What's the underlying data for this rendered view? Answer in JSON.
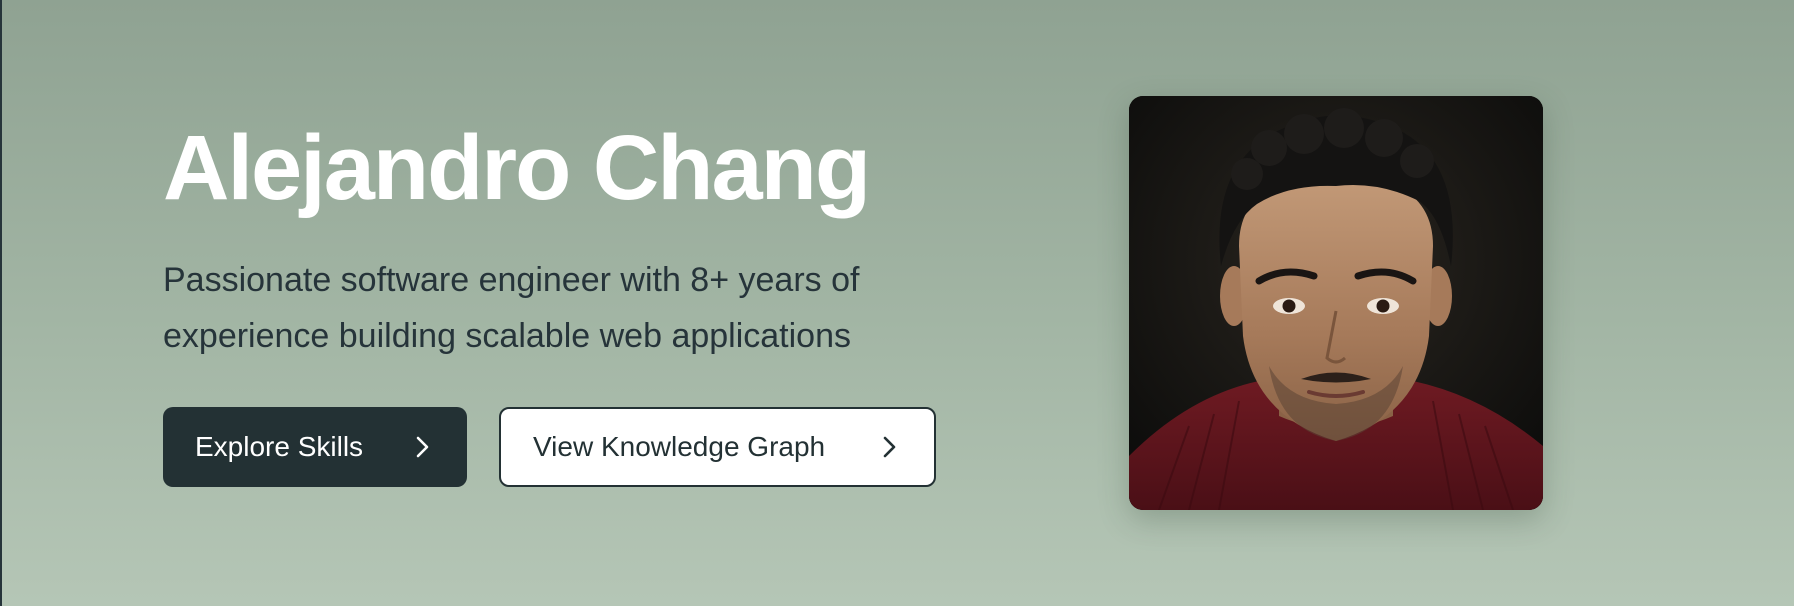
{
  "hero": {
    "name": "Alejandro Chang",
    "tagline": "Passionate software engineer with 8+ years of experience building scalable web applications",
    "buttons": {
      "primary_label": "Explore Skills",
      "secondary_label": "View Knowledge Graph"
    },
    "photo_alt": "Alejandro Chang"
  },
  "icons": {
    "primary_button_icon": "chevron-right-icon",
    "secondary_button_icon": "chevron-right-icon"
  },
  "colors": {
    "hero_gradient_top": "#8fa292",
    "hero_gradient_bottom": "#b5c6b6",
    "heading": "#ffffff",
    "body_text": "#26343a",
    "primary_button_bg": "#233134",
    "secondary_button_bg": "#ffffff"
  }
}
